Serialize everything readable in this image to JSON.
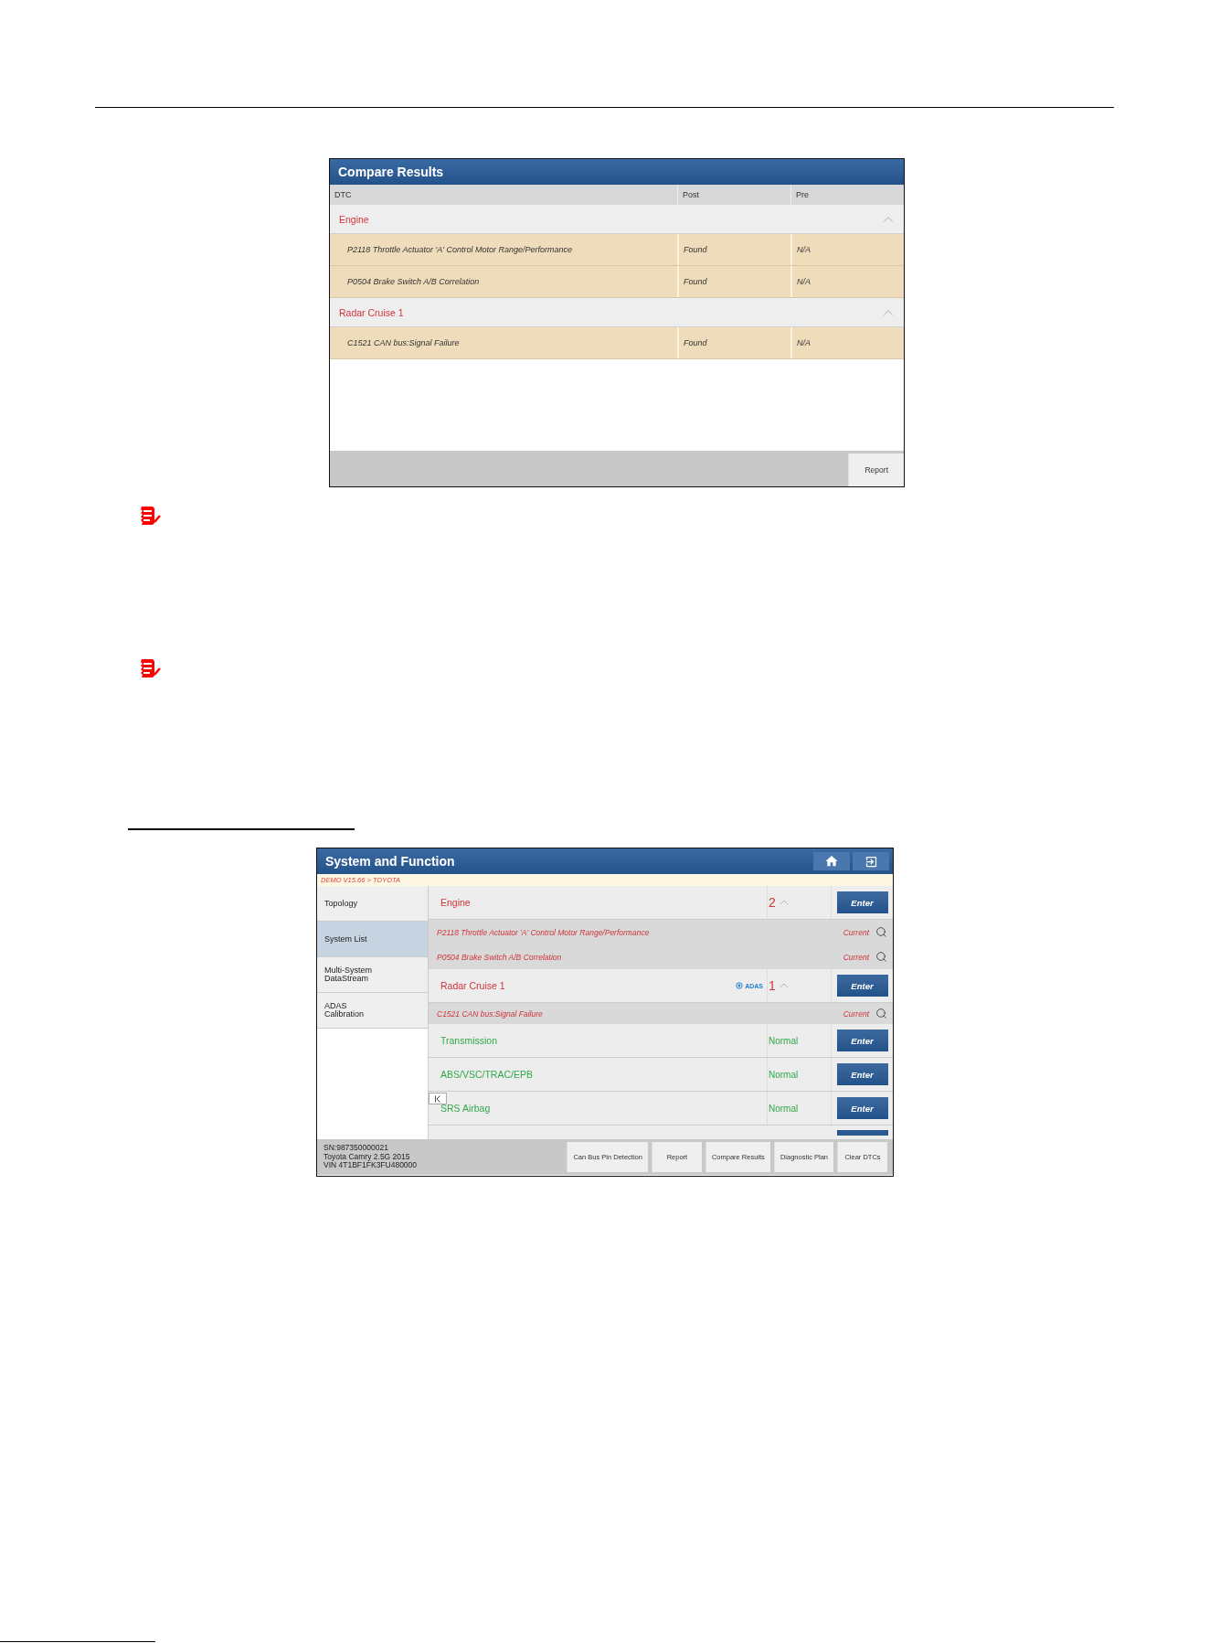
{
  "compare_results": {
    "title": "Compare Results",
    "columns": [
      "DTC",
      "Post",
      "Pre"
    ],
    "groups": [
      {
        "name": "Engine",
        "expanded": true,
        "rows": [
          {
            "dtc": "P2118 Throttle Actuator 'A' Control Motor Range/Performance",
            "post": "Found",
            "pre": "N/A"
          },
          {
            "dtc": "P0504 Brake Switch A/B Correlation",
            "post": "Found",
            "pre": "N/A"
          }
        ]
      },
      {
        "name": "Radar Cruise 1",
        "expanded": true,
        "rows": [
          {
            "dtc": "C1521 CAN bus:Signal Failure",
            "post": "Found",
            "pre": "N/A"
          }
        ]
      }
    ],
    "buttons": [
      "Report"
    ]
  },
  "system_function": {
    "title": "System and Function",
    "breadcrumb": "DEMO V15.66 > TOYOTA",
    "sidebar": [
      {
        "label": "Topology",
        "selected": false
      },
      {
        "label": "System List",
        "selected": true
      },
      {
        "label": "Multi-System DataStream",
        "selected": false
      },
      {
        "label": "ADAS Calibration",
        "selected": false
      }
    ],
    "systems": [
      {
        "kind": "fault",
        "name": "Engine",
        "count": "2",
        "expanded": true,
        "button": "Enter"
      },
      {
        "kind": "dtc",
        "code": "P2118 Throttle Actuator 'A' Control Motor Range/Performance",
        "status": "Current"
      },
      {
        "kind": "dtc",
        "code": "P0504 Brake Switch A/B Correlation",
        "status": "Current"
      },
      {
        "kind": "fault",
        "name": "Radar Cruise 1",
        "badge": "ADAS",
        "count": "1",
        "expanded": true,
        "button": "Enter"
      },
      {
        "kind": "dtc",
        "code": "C1521 CAN bus:Signal Failure",
        "status": "Current"
      },
      {
        "kind": "normal",
        "name": "Transmission",
        "status": "Normal",
        "button": "Enter"
      },
      {
        "kind": "normal",
        "name": "ABS/VSC/TRAC/EPB",
        "status": "Normal",
        "button": "Enter"
      },
      {
        "kind": "normal",
        "name": "SRS Airbag",
        "status": "Normal",
        "button": "Enter"
      }
    ],
    "vehicle_info": [
      "SN:987350000021",
      "Toyota Camry 2.5G 2015",
      "VIN 4T1BF1FK3FU480000"
    ],
    "buttons": [
      "Can Bus Pin Detection",
      "Report",
      "Compare Results",
      "Diagnostic Plan",
      "Clear DTCs"
    ]
  }
}
